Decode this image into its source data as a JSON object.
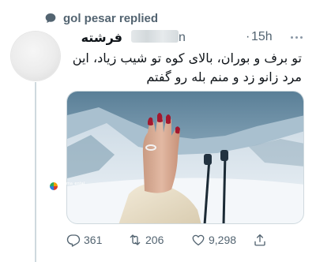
{
  "reply_context": {
    "text": "gol pesar replied"
  },
  "tweet": {
    "display_name": "فرشته",
    "handle_visible": "n",
    "separator": "·",
    "time": "15h",
    "text_line1": "تو برف و بوران، بالای کوه تو شیب زیاد، این",
    "text_line2": "مرد زانو زد و منم بله رو گفتم",
    "media": {
      "watermark_line1": "@sima_ental",
      "watermark_line2": "توییت"
    }
  },
  "actions": {
    "replies": "361",
    "retweets": "206",
    "likes": "9,298"
  },
  "icons": [
    "reply-context-icon",
    "more-icon",
    "reply-icon",
    "retweet-icon",
    "like-icon",
    "share-icon"
  ],
  "colors": {
    "secondary_text": "#536471",
    "thread_line": "#cfd9de",
    "nail_polish": "#a3182e"
  }
}
